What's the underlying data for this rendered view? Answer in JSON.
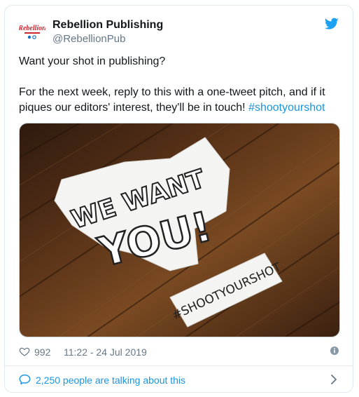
{
  "tweet": {
    "author_name": "Rebellion Publishing",
    "handle": "@RebellionPub",
    "logo_text": "Rebellion",
    "line1": "Want your shot in publishing?",
    "line2": "For the next week, reply to this with a one-tweet pitch, and if it piques our editors' interest, they'll be in touch! ",
    "hashtag": "#shootyourshot"
  },
  "media": {
    "sign_line1": "WE WANT",
    "sign_line2": "YOU!",
    "tag_text": "#SHOOTYOURSHOT"
  },
  "meta": {
    "likes": "992",
    "timestamp": "11:22 - 24 Jul 2019"
  },
  "footer": {
    "talking": "2,250 people are talking about this"
  },
  "colors": {
    "link": "#1b95e0",
    "muted": "#657786",
    "brand_red": "#d0262f"
  },
  "icons": [
    "twitter-bird-icon",
    "heart-icon",
    "info-icon",
    "speech-bubble-icon",
    "chevron-right-icon"
  ]
}
